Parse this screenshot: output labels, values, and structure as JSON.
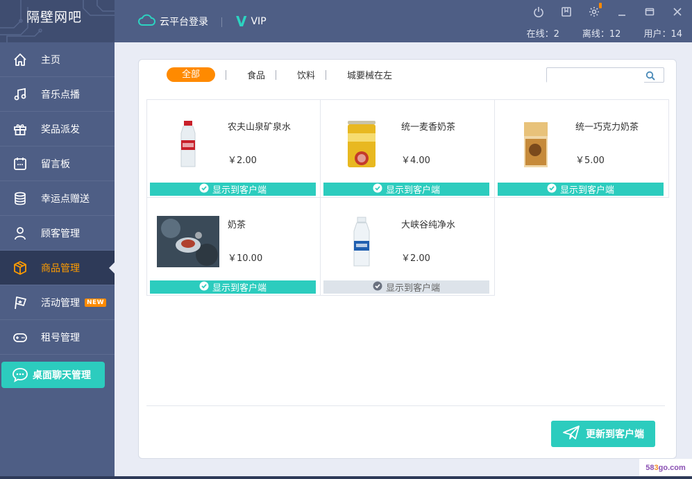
{
  "app": {
    "title": "隔壁网吧"
  },
  "topbar": {
    "cloud_login": "云平台登录",
    "vip": "VIP",
    "stats": {
      "online": "在线：2",
      "offline": "离线：12",
      "users": "用户：14"
    }
  },
  "sidebar": {
    "items": [
      {
        "label": "主页",
        "icon": "home-icon"
      },
      {
        "label": "音乐点播",
        "icon": "music-icon"
      },
      {
        "label": "奖品派发",
        "icon": "gift-icon"
      },
      {
        "label": "留言板",
        "icon": "message-board-icon"
      },
      {
        "label": "幸运点赠送",
        "icon": "coins-icon"
      },
      {
        "label": "顾客管理",
        "icon": "user-icon"
      },
      {
        "label": "商品管理",
        "icon": "box-icon",
        "active": true
      },
      {
        "label": "活动管理",
        "icon": "flag-icon",
        "badge": "NEW"
      },
      {
        "label": "租号管理",
        "icon": "gamepad-icon"
      }
    ],
    "chat_button": "桌面聊天管理"
  },
  "main": {
    "tabs": [
      "全部",
      "食品",
      "饮料",
      "城要械在左"
    ],
    "active_tab": 0,
    "search": {
      "value": "",
      "placeholder": ""
    },
    "products": [
      {
        "name": "农夫山泉矿泉水",
        "price": "￥2.00",
        "show_label": "显示到客户端",
        "shown": true
      },
      {
        "name": "统一麦香奶茶",
        "price": "￥4.00",
        "show_label": "显示到客户端",
        "shown": true
      },
      {
        "name": "统一巧克力奶茶",
        "price": "￥5.00",
        "show_label": "显示到客户端",
        "shown": true
      },
      {
        "name": "奶茶",
        "price": "￥10.00",
        "show_label": "显示到客户端",
        "shown": true
      },
      {
        "name": "大峡谷纯净水",
        "price": "￥2.00",
        "show_label": "显示到客户端",
        "shown": false
      }
    ],
    "update_button": "更新到客户端"
  },
  "watermark": {
    "prefix": "58",
    "highlight": "3",
    "suffix": "go.com"
  },
  "colors": {
    "accent": "#2cccbe",
    "active_nav": "#ff9c00",
    "tab_active": "#ff8a00",
    "sidebar": "#4e5e85"
  }
}
